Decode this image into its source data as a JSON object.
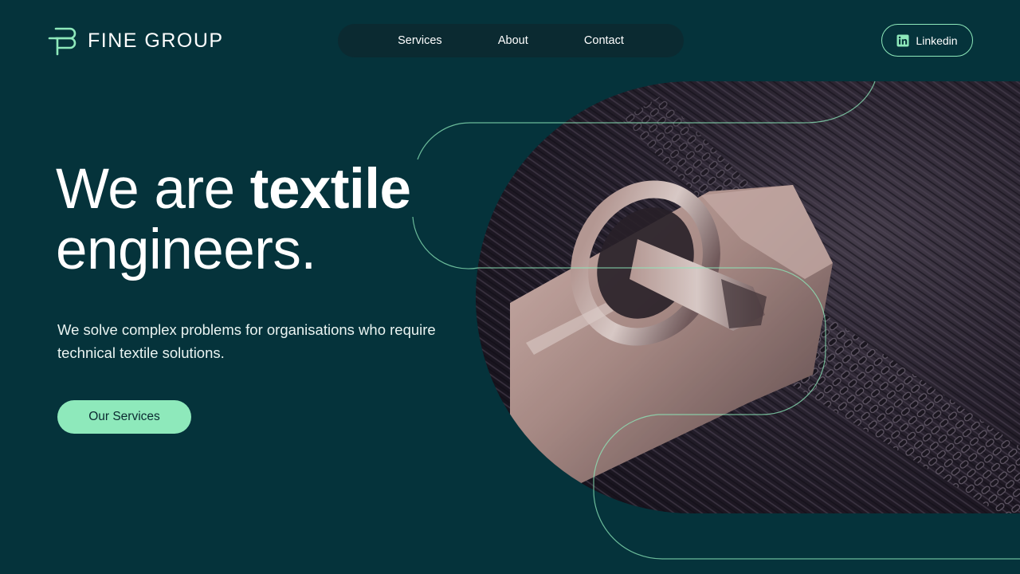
{
  "brand": {
    "name": "FINE GROUP",
    "logo_icon": "fg-monogram-icon"
  },
  "nav": {
    "items": [
      {
        "label": "Services"
      },
      {
        "label": "About"
      },
      {
        "label": "Contact"
      }
    ]
  },
  "header_actions": {
    "linkedin_label": "Linkedin",
    "linkedin_icon": "linkedin-icon"
  },
  "hero": {
    "headline_regular": "We are ",
    "headline_bold": "textile",
    "headline_line2": "engineers",
    "headline_period": ".",
    "subtitle": "We solve complex problems for organisations who require technical textile solutions.",
    "cta_label": "Our Services",
    "image_icon": "zipper-closeup-image"
  },
  "colors": {
    "background": "#05333b",
    "nav_background": "#0b2a31",
    "accent": "#8ee9bb",
    "text": "#ffffff"
  }
}
